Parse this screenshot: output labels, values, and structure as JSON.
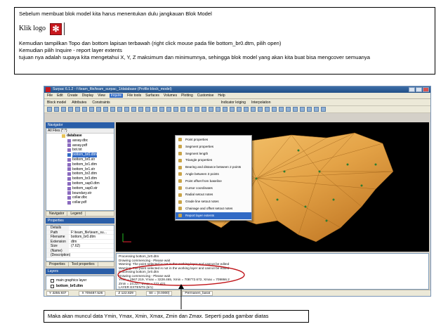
{
  "instructions": {
    "line1": "Sebelum membuat blok model kita harus menentukan dulu jangkauan Blok Model",
    "klik_logo": "Klik logo",
    "logo_icon": "surpac-logo-icon",
    "line3": "Kemudian tampilkan Topo dan bottom lapisan terbawah (right click mouse pada file bottom_br0.dtm, pilih open)",
    "line4": "Kemudian pilih Inquire - report layer extents",
    "line5": "tujuan nya adalah supaya kita mengetahui X, Y, Z maksimum dan minimumnya, sehingga blok model yang akan kita buat bisa mengcover semuanya"
  },
  "app": {
    "title": "Surpac 6.1.2 - f:/team_file/team_surpac_1/database (Profile:block_model)",
    "menus": [
      "File",
      "Edit",
      "Create",
      "Display",
      "View",
      "Inquire",
      "File tools",
      "Surfaces",
      "Volumes",
      "Plotting",
      "Customise",
      "Help"
    ],
    "active_menu": "Inquire",
    "toolbar_labels": [
      "Block model",
      "Attributes",
      "Constraints",
      "Indicator kriging",
      "Interpolation"
    ],
    "left_panel": {
      "navigator_title": "Navigator",
      "filter": "All Files (*.*)",
      "tree_root": "database",
      "tree_items": [
        "assay.dbc",
        "assay.pdf",
        "bot.txt",
        "bottom_br0.dtm",
        "bottom_br0.str",
        "bottom_br1.dtm",
        "bottom_br1.str",
        "bottom_br2.dtm",
        "bottom_br3.dtm",
        "bottom_sap0.dtm",
        "bottom_sap0.str",
        "boundary.str",
        "collar.dbc",
        "collar.pdf"
      ],
      "selected_item": "bottom_br0.dtm",
      "nav_tabs": [
        "Navigator",
        "Legend"
      ],
      "properties_title": "Properties",
      "properties": [
        {
          "key": "Details",
          "value": ""
        },
        {
          "key": "Path",
          "value": "F:\\team_file\\team_su..."
        },
        {
          "key": "Filename",
          "value": "bottom_br0.dtm"
        },
        {
          "key": "Extension",
          "value": "dtm"
        },
        {
          "key": "Size",
          "value": "(7.62)"
        },
        {
          "key": "(Name)",
          "value": ""
        },
        {
          "key": "(Description)",
          "value": ""
        }
      ],
      "prop_tabs": [
        "Properties",
        "Tool properties"
      ],
      "layers_title": "Layers",
      "layers": [
        "main graphics layer",
        "bottom_br0.dtm"
      ]
    },
    "dropdown_items": [
      "Point properties",
      "Segment properties",
      "Segment length",
      "Triangle properties",
      "Bearing and distance between 2 points",
      "Angle between 3 points",
      "Point offset from baseline",
      "Cursor coordinates",
      "Radial setout notes",
      "Grade line setout notes",
      "Chainage and offset setout notes",
      "Report layer extents"
    ],
    "highlighted_item": "Report layer extents",
    "console_lines": [
      "Processing bottom_br0.dtm",
      "Drawing commencing - Please wait",
      "Warning: The point selected is not in the working layer and cannot be edited",
      "Warning: The point selected is not in the working layer and cannot be edited",
      "Processing bottom_br0.dtm",
      "Drawing commencing - Please wait",
      "Ymin = 2567.219, Ymax = 3228.465, Xmin = 708772.672, Xmax = 709866.2",
      "Zmin = 23.227, Zmax = 222.421",
      "LAYER EXTENTS (6/1)"
    ],
    "status": {
      "y": "Y 3255.937",
      "x": "X 709487.526",
      "z": "Z 122.829",
      "str": "Str = (0.0000)",
      "mode": "Permanen_barat"
    }
  },
  "caption": "Maka akan muncul data  Ymin, Ymax, Xmin, Xmax, Zmin dan Zmax. Seperti pada gambar diatas",
  "colors": {
    "ellipse": "#c0151a",
    "terrain_light": "#f7c974",
    "terrain_dark": "#b86d1c",
    "viewport_bg": "#000000"
  }
}
